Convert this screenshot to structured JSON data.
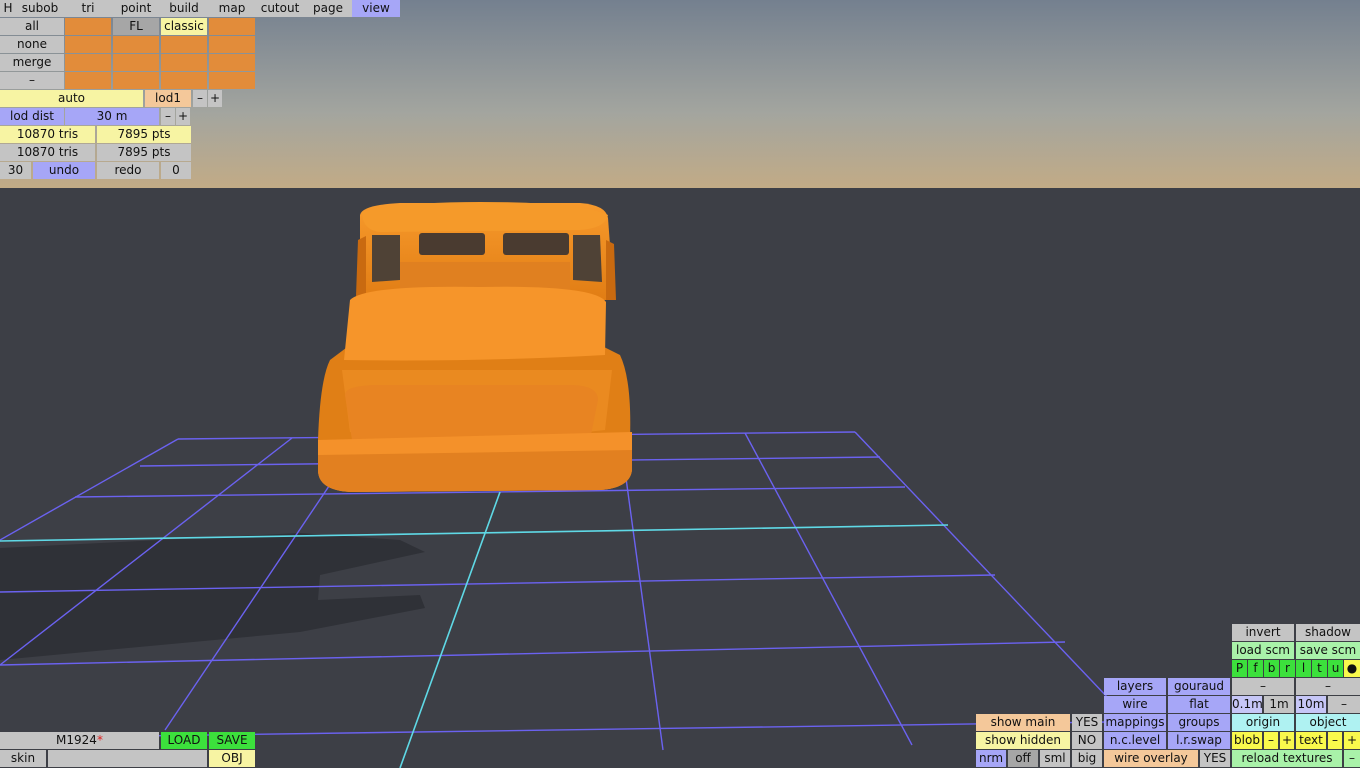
{
  "colors": {
    "sky_top": "#7f8b9b",
    "sky_bottom": "#b9a98e",
    "ground": "#3d3f46",
    "grid": "#6b62f0",
    "grid_axis": "#5fd9e6",
    "model": "#f28a1c",
    "shadow": "#2f3137"
  },
  "menu": {
    "h": "H",
    "tabs": [
      "subob",
      "tri",
      "point",
      "build",
      "map",
      "cutout",
      "page",
      "view"
    ]
  },
  "select": {
    "all": "all",
    "none": "none",
    "merge": "merge",
    "minus": "–",
    "fl": "FL",
    "classic": "classic"
  },
  "lod": {
    "auto": "auto",
    "lod1": "lod1",
    "minus": "–",
    "plus": "+",
    "dist_label": "lod dist",
    "dist_value": "30 m"
  },
  "stats": {
    "row1_tris": "10870 tris",
    "row1_pts": "7895 pts",
    "row2_tris": "10870 tris",
    "row2_pts": "7895 pts"
  },
  "history": {
    "count": "30",
    "undo": "undo",
    "redo": "redo",
    "redo_count": "0"
  },
  "file": {
    "name": "M1924",
    "modified": "*",
    "load": "LOAD",
    "save": "SAVE",
    "skin": "skin",
    "obj": "OBJ"
  },
  "display": {
    "show_main": "show main",
    "show_main_val": "YES",
    "show_hidden": "show hidden",
    "show_hidden_val": "NO",
    "nrm": "nrm",
    "off": "off",
    "sml": "sml",
    "big": "big",
    "layers": "layers",
    "gouraud": "gouraud",
    "wire": "wire",
    "flat": "flat",
    "mappings": "mappings",
    "groups": "groups",
    "nc_level": "n.c.level",
    "lr_swap": "l.r.swap",
    "wire_overlay": "wire overlay",
    "wire_overlay_val": "YES"
  },
  "right": {
    "invert": "invert",
    "shadow": "shadow",
    "load_scm": "load scm",
    "save_scm": "save scm",
    "views": [
      "P",
      "f",
      "b",
      "r",
      "l",
      "t",
      "u"
    ],
    "dot": "●",
    "dash1": "–",
    "dash2": "–",
    "g01": "0.1m",
    "g1": "1m",
    "g10": "10m",
    "gminus": "–",
    "origin": "origin",
    "object": "object",
    "blob": "blob",
    "blob_minus": "–",
    "blob_plus": "+",
    "text": "text",
    "text_minus": "–",
    "text_plus": "+",
    "reload": "reload textures",
    "reload_minus": "–"
  }
}
